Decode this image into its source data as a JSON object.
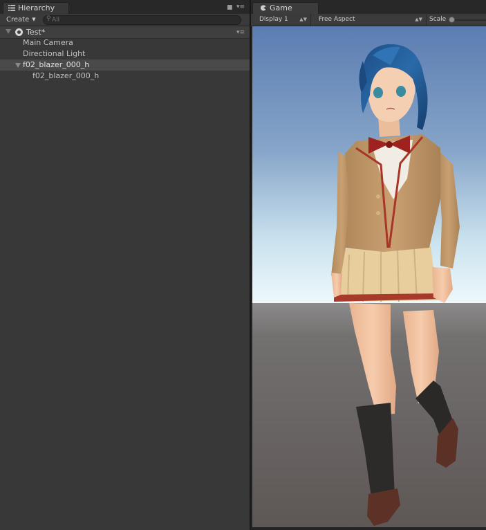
{
  "hierarchy": {
    "tab_label": "Hierarchy",
    "tab_icon": "list-icon",
    "create_label": "Create",
    "search_placeholder": "All",
    "scene_name": "Test*",
    "items": [
      {
        "label": "Main Camera",
        "depth": 1,
        "selected": false
      },
      {
        "label": "Directional Light",
        "depth": 1,
        "selected": false
      },
      {
        "label": "f02_blazer_000_h",
        "depth": 1,
        "selected": true,
        "expanded": true
      },
      {
        "label": "f02_blazer_000_h",
        "depth": 2,
        "selected": false
      }
    ]
  },
  "game": {
    "tab_label": "Game",
    "tab_icon": "game-controller-icon",
    "display_label": "Display 1",
    "aspect_label": "Free Aspect",
    "scale_label": "Scale"
  },
  "colors": {
    "panel_bg": "#383838",
    "selection": "#4a4a4a",
    "sky_top": "#5d7fb3",
    "sky_horizon": "#e4f1f7",
    "ground": "#6a6462"
  }
}
